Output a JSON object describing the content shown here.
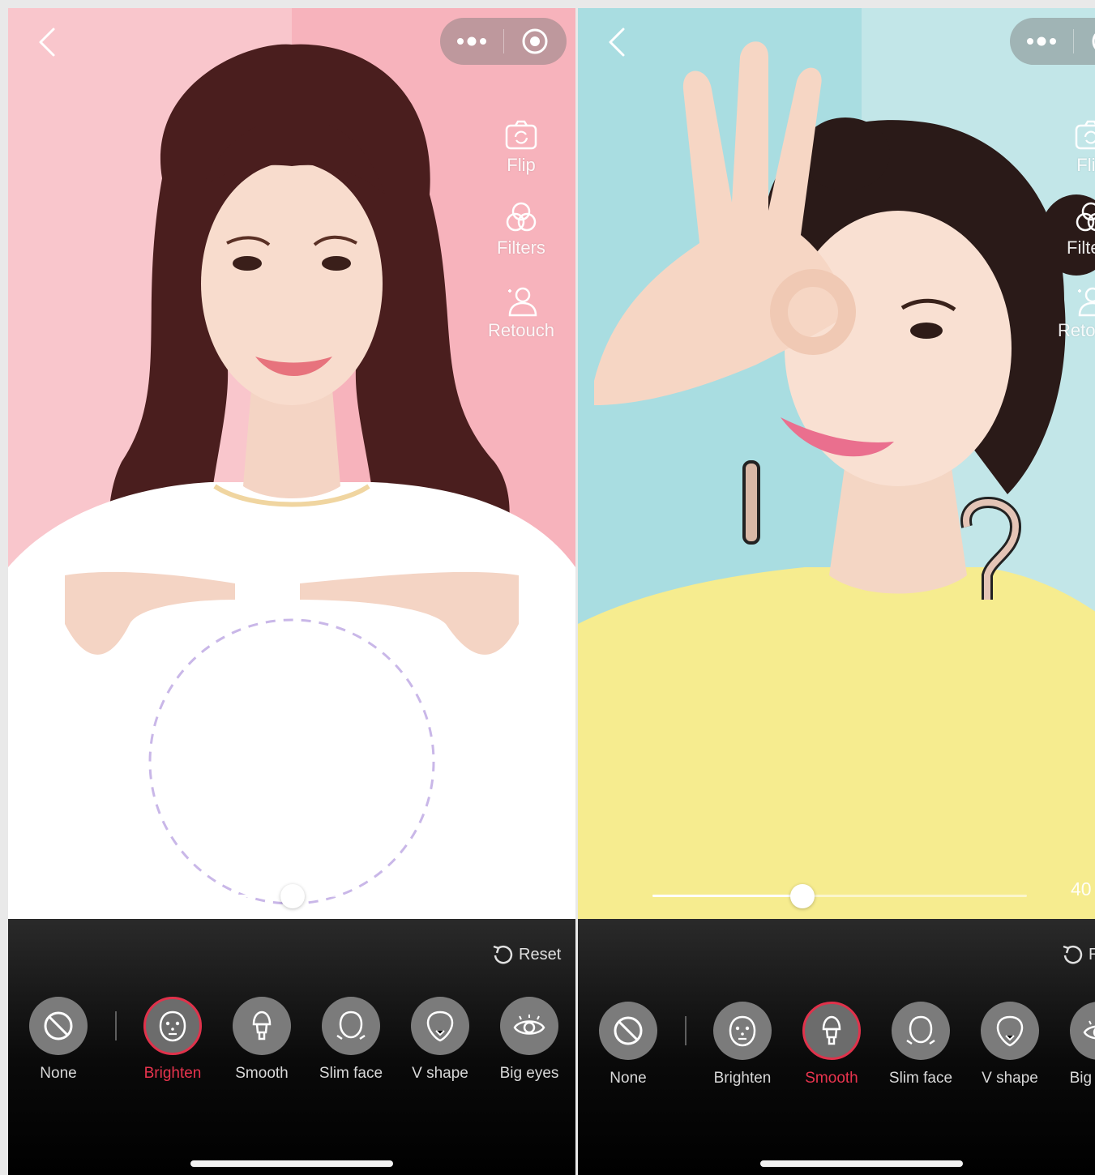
{
  "screens": [
    {
      "id": "left",
      "side_tools": [
        {
          "label": "Flip",
          "icon": "flip-camera-icon"
        },
        {
          "label": "Filters",
          "icon": "filters-icon"
        },
        {
          "label": "Retouch",
          "icon": "retouch-icon"
        }
      ],
      "slider_value": "55",
      "slider_fraction": 0.55,
      "reset_label": "Reset",
      "selected_effect": "Brighten",
      "effects": [
        "None",
        "Brighten",
        "Smooth",
        "Slim face",
        "V shape",
        "Big eyes"
      ],
      "colors": {
        "background": "#f9c6cc",
        "background_right": "#f7b3bc",
        "shirt": "#ffffff"
      }
    },
    {
      "id": "right",
      "side_tools": [
        {
          "label": "Flip",
          "icon": "flip-camera-icon"
        },
        {
          "label": "Filters",
          "icon": "filters-icon"
        },
        {
          "label": "Retouch",
          "icon": "retouch-icon"
        }
      ],
      "slider_value": "40",
      "slider_fraction": 0.4,
      "reset_label": "Reset",
      "selected_effect": "Smooth",
      "effects": [
        "None",
        "Brighten",
        "Smooth",
        "Slim face",
        "V shape",
        "Big eyes"
      ],
      "colors": {
        "background": "#a9dde1",
        "background_right": "#c2e6e8",
        "shirt": "#f6ec8f"
      }
    }
  ],
  "accent_color": "#e0324b"
}
